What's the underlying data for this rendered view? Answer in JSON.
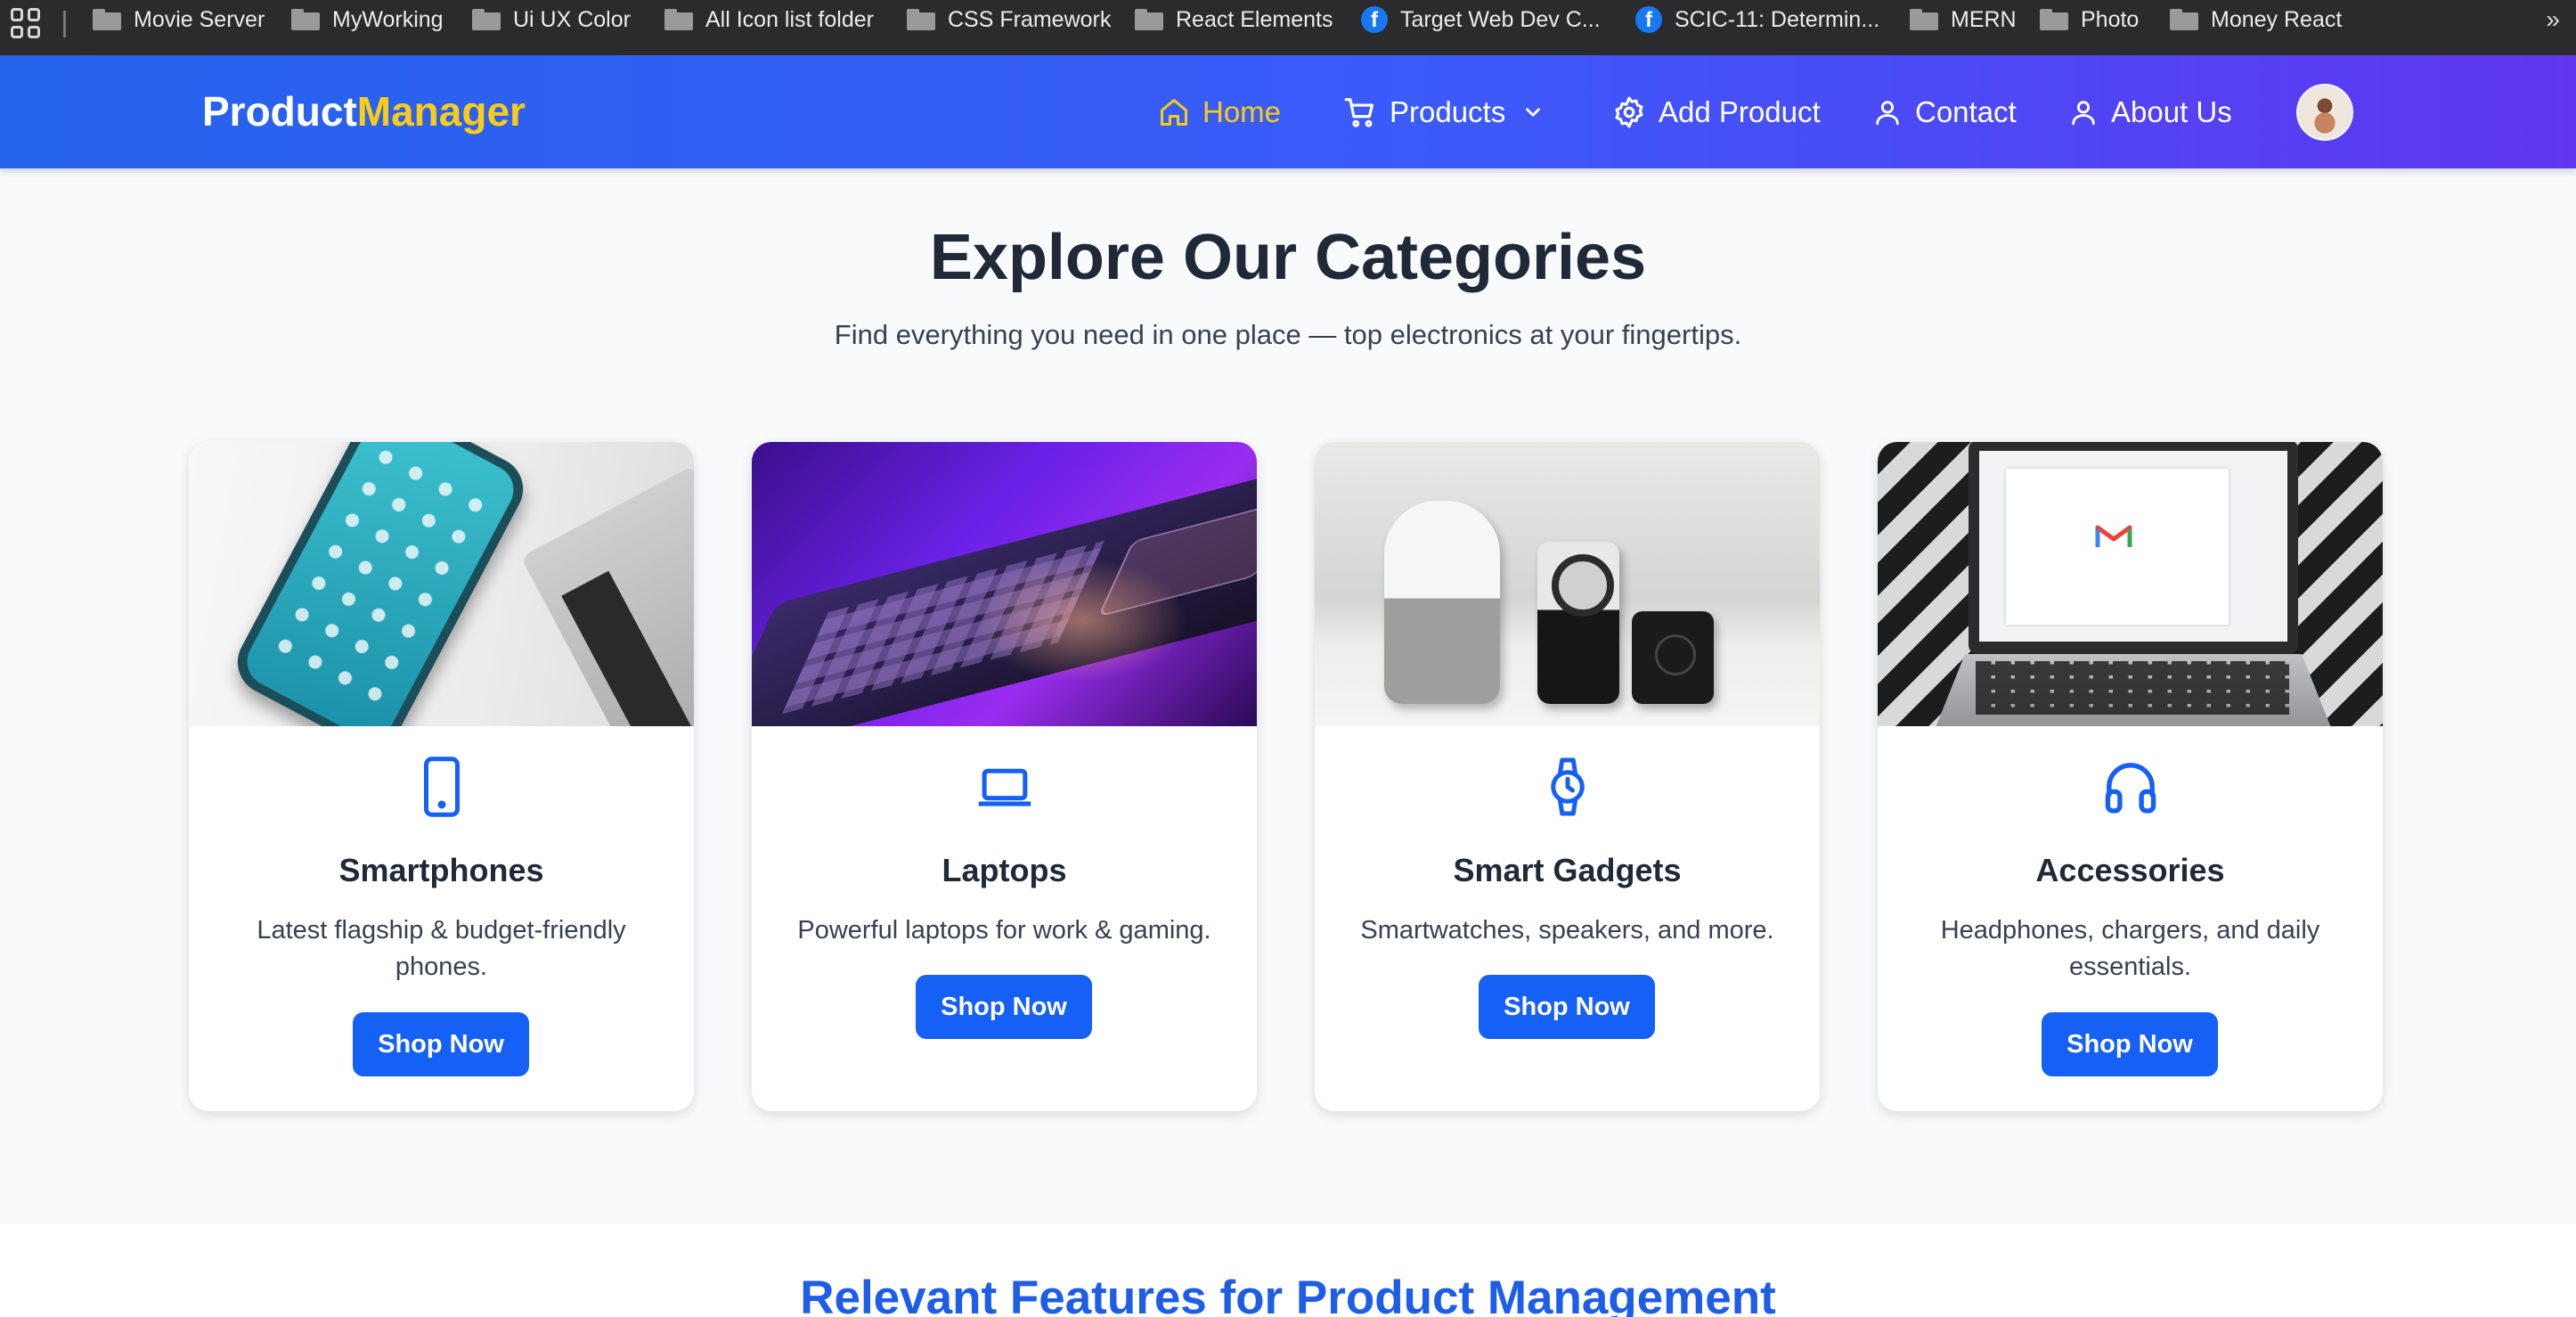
{
  "bookmarks": [
    {
      "label": "Movie Server",
      "icon": "folder-icon"
    },
    {
      "label": "MyWorking",
      "icon": "folder-icon"
    },
    {
      "label": "Ui UX Color",
      "icon": "folder-icon"
    },
    {
      "label": "All Icon list folder",
      "icon": "folder-icon"
    },
    {
      "label": "CSS Framework",
      "icon": "folder-icon"
    },
    {
      "label": "React Elements",
      "icon": "folder-icon"
    },
    {
      "label": "Target Web Dev C...",
      "icon": "facebook-icon"
    },
    {
      "label": "SCIC-11: Determin...",
      "icon": "facebook-icon"
    },
    {
      "label": "MERN",
      "icon": "folder-icon"
    },
    {
      "label": "Photo",
      "icon": "folder-icon"
    },
    {
      "label": "Money React",
      "icon": "folder-icon"
    }
  ],
  "bookmarks_more": "»",
  "brand": {
    "part1": "Product",
    "part2": "Manager"
  },
  "nav": {
    "home": "Home",
    "products": "Products",
    "add_product": "Add Product",
    "contact": "Contact",
    "about": "About Us"
  },
  "hero": {
    "title": "Explore Our Categories",
    "subtitle": "Find everything you need in one place — top electronics at your fingertips."
  },
  "categories": [
    {
      "title": "Smartphones",
      "description": "Latest flagship & budget-friendly phones.",
      "button": "Shop Now",
      "icon": "smartphone-icon"
    },
    {
      "title": "Laptops",
      "description": "Powerful laptops for work & gaming.",
      "button": "Shop Now",
      "icon": "laptop-icon"
    },
    {
      "title": "Smart Gadgets",
      "description": "Smartwatches, speakers, and more.",
      "button": "Shop Now",
      "icon": "watch-icon"
    },
    {
      "title": "Accessories",
      "description": "Headphones, chargers, and daily essentials.",
      "button": "Shop Now",
      "icon": "headphones-icon"
    }
  ],
  "features": {
    "title": "Relevant Features for Product Management"
  },
  "colors": {
    "nav_gradient_start": "#2563eb",
    "nav_gradient_end": "#6035f0",
    "brand_accent": "#facc15",
    "button": "#1560f5",
    "features_title": "#1d5de8"
  }
}
